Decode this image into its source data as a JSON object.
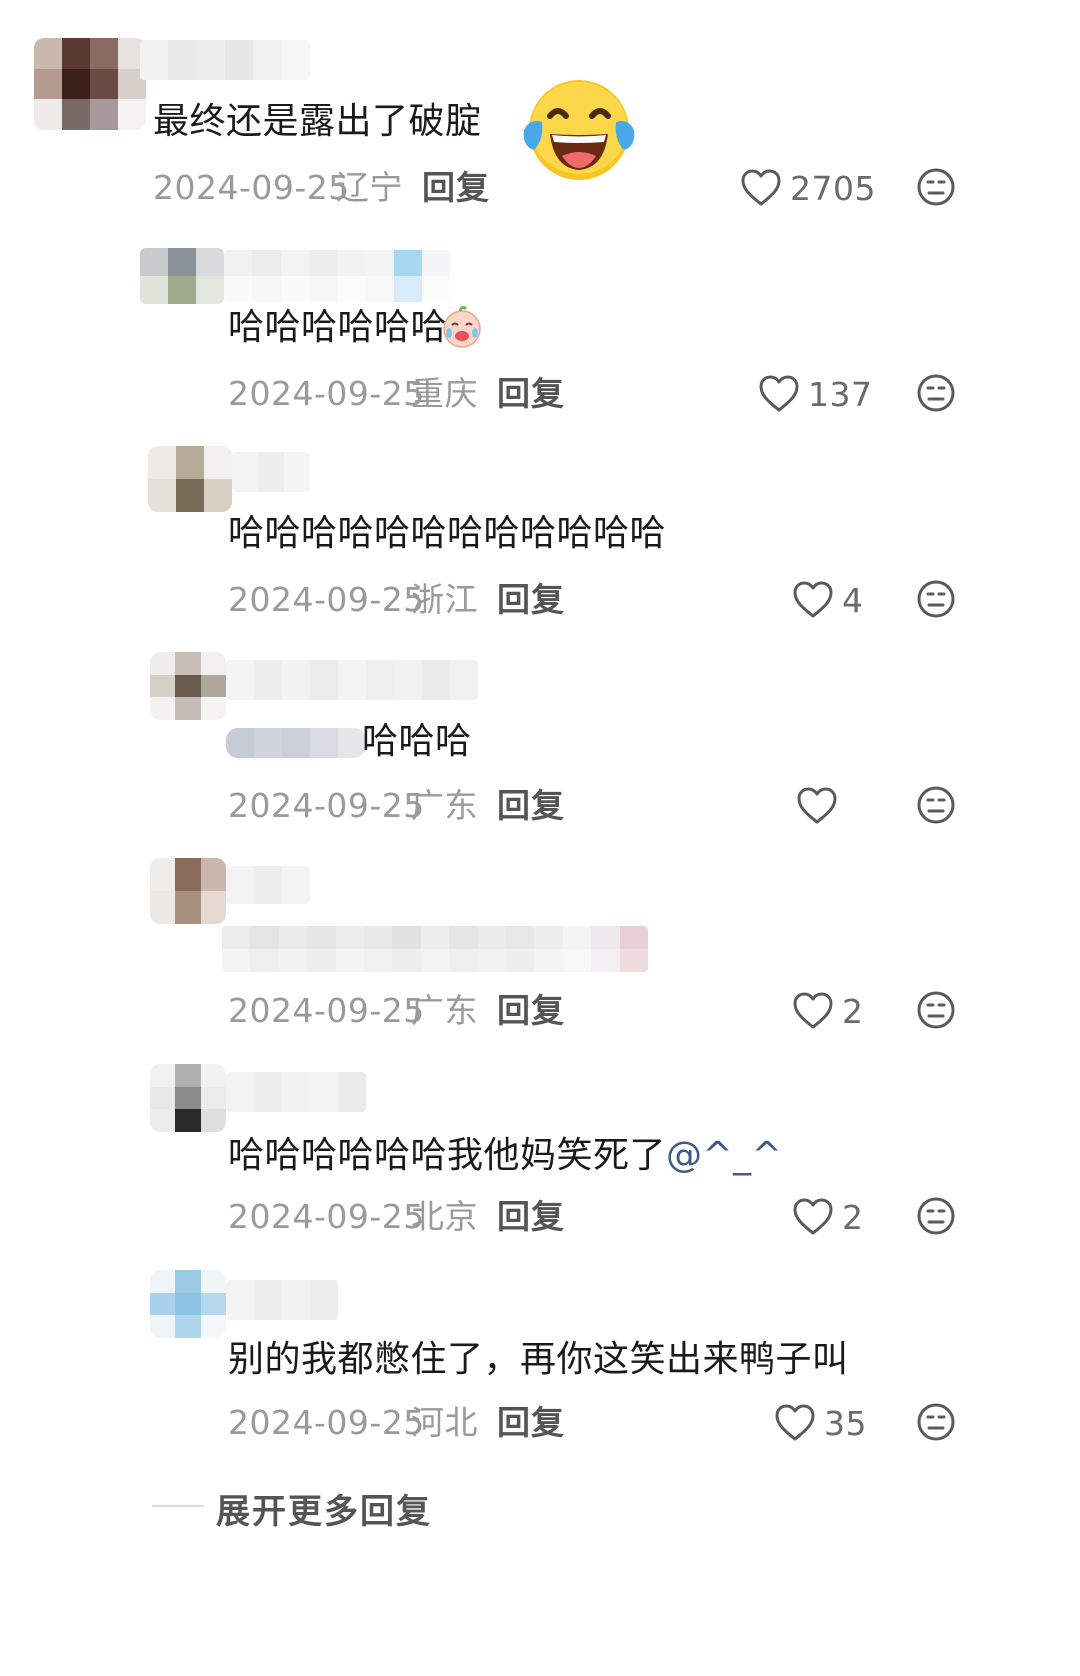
{
  "thread": {
    "top_comment": {
      "text": "最终还是露出了破腚",
      "emoji_icon": "tears-of-joy-emoji-icon",
      "date": "2024-09-25",
      "location": "辽宁",
      "reply_label": "回复",
      "likes": "2705"
    },
    "replies": [
      {
        "text": "哈哈哈哈哈哈",
        "emoji_icon": "crying-baby-emoji-icon",
        "date": "2024-09-25",
        "location": "重庆",
        "reply_label": "回复",
        "likes": "137"
      },
      {
        "text": "哈哈哈哈哈哈哈哈哈哈哈哈",
        "date": "2024-09-25",
        "location": "浙江",
        "reply_label": "回复",
        "likes": "4"
      },
      {
        "text": "哈哈哈",
        "date": "2024-09-25",
        "location": "广东",
        "reply_label": "回复",
        "likes": ""
      },
      {
        "text": "",
        "date": "2024-09-25",
        "location": "广东",
        "reply_label": "回复",
        "likes": "2"
      },
      {
        "text": "哈哈哈哈哈哈我他妈笑死了",
        "mention": "@^_^",
        "date": "2024-09-25",
        "location": "北京",
        "reply_label": "回复",
        "likes": "2"
      },
      {
        "text": "别的我都憋住了，再你这笑出来鸭子叫",
        "date": "2024-09-25",
        "location": "河北",
        "reply_label": "回复",
        "likes": "35"
      }
    ],
    "expand_more_label": "展开更多回复"
  },
  "icons": {
    "like": "heart-outline-icon",
    "dislike": "meh-face-icon"
  },
  "colors": {
    "text": "#1a1a1a",
    "meta": "#9a9a9a",
    "reply": "#555555",
    "icon": "#5a5a5a"
  }
}
